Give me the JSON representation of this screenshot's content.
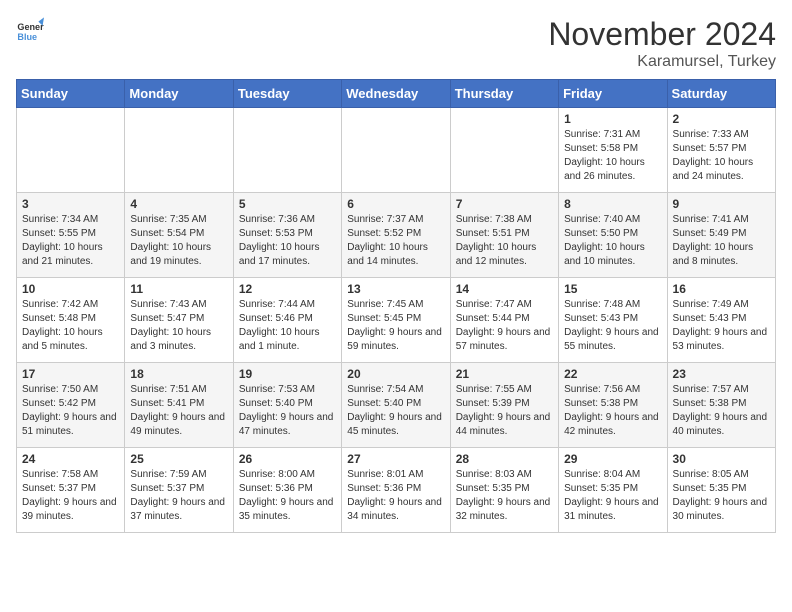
{
  "logo": {
    "line1": "General",
    "line2": "Blue"
  },
  "title": "November 2024",
  "subtitle": "Karamursel, Turkey",
  "weekdays": [
    "Sunday",
    "Monday",
    "Tuesday",
    "Wednesday",
    "Thursday",
    "Friday",
    "Saturday"
  ],
  "weeks": [
    [
      {
        "day": "",
        "info": ""
      },
      {
        "day": "",
        "info": ""
      },
      {
        "day": "",
        "info": ""
      },
      {
        "day": "",
        "info": ""
      },
      {
        "day": "",
        "info": ""
      },
      {
        "day": "1",
        "info": "Sunrise: 7:31 AM\nSunset: 5:58 PM\nDaylight: 10 hours\nand 26 minutes."
      },
      {
        "day": "2",
        "info": "Sunrise: 7:33 AM\nSunset: 5:57 PM\nDaylight: 10 hours\nand 24 minutes."
      }
    ],
    [
      {
        "day": "3",
        "info": "Sunrise: 7:34 AM\nSunset: 5:55 PM\nDaylight: 10 hours\nand 21 minutes."
      },
      {
        "day": "4",
        "info": "Sunrise: 7:35 AM\nSunset: 5:54 PM\nDaylight: 10 hours\nand 19 minutes."
      },
      {
        "day": "5",
        "info": "Sunrise: 7:36 AM\nSunset: 5:53 PM\nDaylight: 10 hours\nand 17 minutes."
      },
      {
        "day": "6",
        "info": "Sunrise: 7:37 AM\nSunset: 5:52 PM\nDaylight: 10 hours\nand 14 minutes."
      },
      {
        "day": "7",
        "info": "Sunrise: 7:38 AM\nSunset: 5:51 PM\nDaylight: 10 hours\nand 12 minutes."
      },
      {
        "day": "8",
        "info": "Sunrise: 7:40 AM\nSunset: 5:50 PM\nDaylight: 10 hours\nand 10 minutes."
      },
      {
        "day": "9",
        "info": "Sunrise: 7:41 AM\nSunset: 5:49 PM\nDaylight: 10 hours\nand 8 minutes."
      }
    ],
    [
      {
        "day": "10",
        "info": "Sunrise: 7:42 AM\nSunset: 5:48 PM\nDaylight: 10 hours\nand 5 minutes."
      },
      {
        "day": "11",
        "info": "Sunrise: 7:43 AM\nSunset: 5:47 PM\nDaylight: 10 hours\nand 3 minutes."
      },
      {
        "day": "12",
        "info": "Sunrise: 7:44 AM\nSunset: 5:46 PM\nDaylight: 10 hours\nand 1 minute."
      },
      {
        "day": "13",
        "info": "Sunrise: 7:45 AM\nSunset: 5:45 PM\nDaylight: 9 hours\nand 59 minutes."
      },
      {
        "day": "14",
        "info": "Sunrise: 7:47 AM\nSunset: 5:44 PM\nDaylight: 9 hours\nand 57 minutes."
      },
      {
        "day": "15",
        "info": "Sunrise: 7:48 AM\nSunset: 5:43 PM\nDaylight: 9 hours\nand 55 minutes."
      },
      {
        "day": "16",
        "info": "Sunrise: 7:49 AM\nSunset: 5:43 PM\nDaylight: 9 hours\nand 53 minutes."
      }
    ],
    [
      {
        "day": "17",
        "info": "Sunrise: 7:50 AM\nSunset: 5:42 PM\nDaylight: 9 hours\nand 51 minutes."
      },
      {
        "day": "18",
        "info": "Sunrise: 7:51 AM\nSunset: 5:41 PM\nDaylight: 9 hours\nand 49 minutes."
      },
      {
        "day": "19",
        "info": "Sunrise: 7:53 AM\nSunset: 5:40 PM\nDaylight: 9 hours\nand 47 minutes."
      },
      {
        "day": "20",
        "info": "Sunrise: 7:54 AM\nSunset: 5:40 PM\nDaylight: 9 hours\nand 45 minutes."
      },
      {
        "day": "21",
        "info": "Sunrise: 7:55 AM\nSunset: 5:39 PM\nDaylight: 9 hours\nand 44 minutes."
      },
      {
        "day": "22",
        "info": "Sunrise: 7:56 AM\nSunset: 5:38 PM\nDaylight: 9 hours\nand 42 minutes."
      },
      {
        "day": "23",
        "info": "Sunrise: 7:57 AM\nSunset: 5:38 PM\nDaylight: 9 hours\nand 40 minutes."
      }
    ],
    [
      {
        "day": "24",
        "info": "Sunrise: 7:58 AM\nSunset: 5:37 PM\nDaylight: 9 hours\nand 39 minutes."
      },
      {
        "day": "25",
        "info": "Sunrise: 7:59 AM\nSunset: 5:37 PM\nDaylight: 9 hours\nand 37 minutes."
      },
      {
        "day": "26",
        "info": "Sunrise: 8:00 AM\nSunset: 5:36 PM\nDaylight: 9 hours\nand 35 minutes."
      },
      {
        "day": "27",
        "info": "Sunrise: 8:01 AM\nSunset: 5:36 PM\nDaylight: 9 hours\nand 34 minutes."
      },
      {
        "day": "28",
        "info": "Sunrise: 8:03 AM\nSunset: 5:35 PM\nDaylight: 9 hours\nand 32 minutes."
      },
      {
        "day": "29",
        "info": "Sunrise: 8:04 AM\nSunset: 5:35 PM\nDaylight: 9 hours\nand 31 minutes."
      },
      {
        "day": "30",
        "info": "Sunrise: 8:05 AM\nSunset: 5:35 PM\nDaylight: 9 hours\nand 30 minutes."
      }
    ]
  ]
}
